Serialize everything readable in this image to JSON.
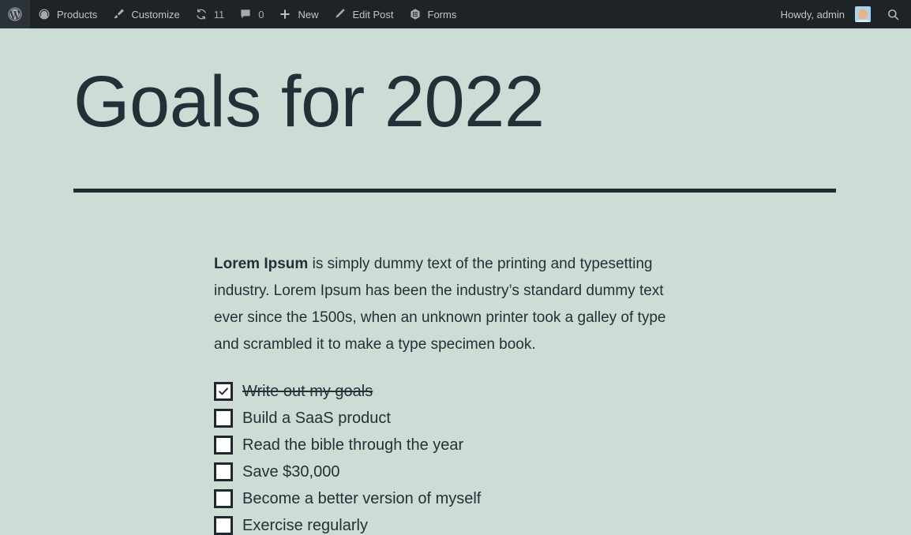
{
  "adminbar": {
    "wp_logo": "wordpress-logo",
    "left_items": [
      {
        "icon": "dashboard-icon",
        "label": "Products"
      },
      {
        "icon": "paintbrush-icon",
        "label": "Customize"
      },
      {
        "icon": "updates-icon",
        "label": "11"
      },
      {
        "icon": "comment-icon",
        "label": "0"
      },
      {
        "icon": "plus-icon",
        "label": "New"
      },
      {
        "icon": "pencil-icon",
        "label": "Edit Post"
      },
      {
        "icon": "forms-icon",
        "label": "Forms"
      }
    ],
    "howdy": "Howdy, admin",
    "avatar": "user-avatar",
    "search_icon": "search-icon"
  },
  "page": {
    "title": "Goals for 2022",
    "intro_bold": "Lorem Ipsum",
    "intro_rest": " is simply dummy text of the printing and typesetting industry. Lorem Ipsum has been the industry’s standard dummy text ever since the 1500s, when an unknown printer took a galley of type and scrambled it to make a type specimen book.",
    "tasks": [
      {
        "label": "Write out my goals",
        "checked": true
      },
      {
        "label": "Build a SaaS product",
        "checked": false
      },
      {
        "label": "Read the bible through the year",
        "checked": false
      },
      {
        "label": "Save $30,000",
        "checked": false
      },
      {
        "label": "Become a better version of myself",
        "checked": false
      },
      {
        "label": "Exercise regularly",
        "checked": false
      }
    ]
  },
  "colors": {
    "background": "#cedcd6",
    "text": "#252f38",
    "adminbar_bg": "#1d2327",
    "adminbar_text": "#c3c4c7",
    "rule": "#1f2a33"
  }
}
